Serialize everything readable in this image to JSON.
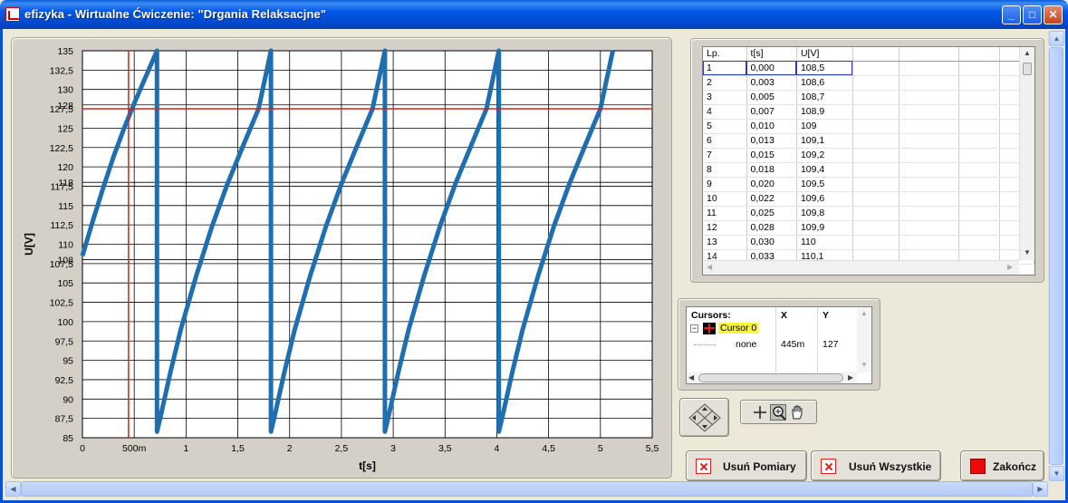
{
  "window": {
    "title": "efizyka - Wirtualne Ćwiczenie: \"Drgania Relaksacjne\"",
    "buttons": {
      "minimize": "_",
      "maximize": "□",
      "close": "✕"
    }
  },
  "chart_data": {
    "type": "line",
    "xlabel": "t[s]",
    "ylabel": "U[V]",
    "xlim": [
      0,
      5.5
    ],
    "ylim": [
      85,
      135
    ],
    "x_ticks": [
      0,
      0.5,
      1,
      1.5,
      2,
      2.5,
      3,
      3.5,
      4,
      4.5,
      5,
      5.5
    ],
    "x_tick_labels": [
      "0",
      "500m",
      "1",
      "1,5",
      "2",
      "2,5",
      "3",
      "3,5",
      "4",
      "4,5",
      "5",
      "5,5"
    ],
    "y_ticks": [
      85,
      87.5,
      90,
      92.5,
      95,
      97.5,
      100,
      102.5,
      105,
      107.5,
      108,
      110,
      112.5,
      115,
      117.5,
      118,
      120,
      122.5,
      125,
      127.5,
      128,
      130,
      132.5,
      135
    ],
    "y_tick_labels": [
      "85",
      "87,5",
      "90",
      "92,5",
      "95",
      "97,5",
      "100",
      "102,5",
      "105",
      "107,5",
      "108",
      "110",
      "112,5",
      "115",
      "117,5",
      "118",
      "120",
      "122,5",
      "125",
      "127,5",
      "128",
      "130",
      "132,5",
      "135"
    ],
    "grid": true,
    "series": [
      {
        "color": "#1f6fb0",
        "x": [
          0,
          0.1,
          0.2,
          0.3,
          0.4,
          0.5,
          0.6,
          0.72,
          0.72,
          0.75,
          0.85,
          0.95,
          1.1,
          1.25,
          1.4,
          1.55,
          1.7,
          1.82,
          1.82,
          1.85,
          1.95,
          2.05,
          2.2,
          2.35,
          2.5,
          2.65,
          2.8,
          2.92,
          2.92,
          2.95,
          3.05,
          3.15,
          3.3,
          3.45,
          3.6,
          3.75,
          3.9,
          4.02,
          4.02,
          4.05,
          4.15,
          4.25,
          4.4,
          4.55,
          4.7,
          4.85,
          5.0,
          5.12
        ],
        "y": [
          108.5,
          113.0,
          117.3,
          121.3,
          124.9,
          128.2,
          131.3,
          135,
          85.8,
          87.5,
          93.5,
          99.0,
          106.0,
          112.3,
          117.8,
          122.7,
          127.5,
          135,
          85.8,
          87.5,
          93.5,
          99.0,
          106.0,
          112.3,
          117.8,
          122.7,
          127.5,
          135,
          85.8,
          87.5,
          93.5,
          99.0,
          106.0,
          112.3,
          117.8,
          122.7,
          127.5,
          135,
          85.8,
          87.5,
          93.5,
          99.0,
          106.0,
          112.3,
          117.8,
          122.7,
          127.5,
          135
        ]
      }
    ],
    "cursor": {
      "x": 0.445,
      "y": 127.5,
      "color": "#d42020"
    }
  },
  "table": {
    "headers": [
      "Lp.",
      "t[s]",
      "U[V]",
      "",
      "",
      "",
      ""
    ],
    "rows": [
      [
        "1",
        "0,000",
        "108,5"
      ],
      [
        "2",
        "0,003",
        "108,6"
      ],
      [
        "3",
        "0,005",
        "108,7"
      ],
      [
        "4",
        "0,007",
        "108,9"
      ],
      [
        "5",
        "0,010",
        "109"
      ],
      [
        "6",
        "0,013",
        "109,1"
      ],
      [
        "7",
        "0,015",
        "109,2"
      ],
      [
        "8",
        "0,018",
        "109,4"
      ],
      [
        "9",
        "0,020",
        "109,5"
      ],
      [
        "10",
        "0,022",
        "109,6"
      ],
      [
        "11",
        "0,025",
        "109,8"
      ],
      [
        "12",
        "0,028",
        "109,9"
      ],
      [
        "13",
        "0,030",
        "110"
      ],
      [
        "14",
        "0,033",
        "110,1"
      ]
    ]
  },
  "cursors": {
    "header": {
      "name": "Cursors:",
      "x": "X",
      "y": "Y"
    },
    "items": [
      {
        "name": "Cursor 0",
        "sub": "none",
        "x": "445m",
        "y": "127"
      }
    ]
  },
  "buttons": {
    "remove_measurements": "Usuń Pomiary",
    "remove_all": "Usuń Wszystkie",
    "finish": "Zakończ"
  }
}
